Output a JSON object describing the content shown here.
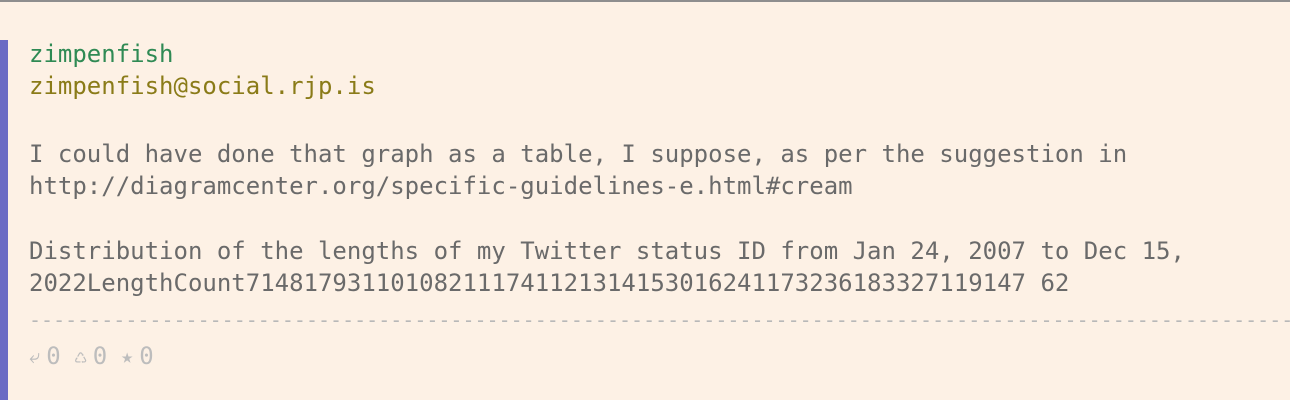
{
  "post": {
    "display_name": "zimpenfish",
    "handle": "zimpenfish@social.rjp.is",
    "paragraph1_line1": "I could have done that graph as a table, I suppose, as per the suggestion in",
    "paragraph1_line2": "http://diagramcenter.org/specific-guidelines-e.html#cream",
    "paragraph2_line1": "Distribution of the lengths of my Twitter status ID from Jan 24, 2007 to Dec 15,",
    "paragraph2_line2": "2022LengthCount714817931101082111741121314153016241173236183327119147 62"
  },
  "divider": "------------------------------------------------------------------------------------------------------------------------------",
  "stats": {
    "replies_icon": "reply-icon",
    "replies": "0",
    "boosts_icon": "recycle-icon",
    "boosts": "0",
    "favourites_icon": "star-icon",
    "favourites": "0"
  },
  "colors": {
    "background": "#fdf1e5",
    "accent_bar": "#6b6bc4",
    "display_name": "#2f8a54",
    "handle": "#8a7b18",
    "body_text": "#6a6a6a",
    "muted": "#bdbdbd"
  }
}
